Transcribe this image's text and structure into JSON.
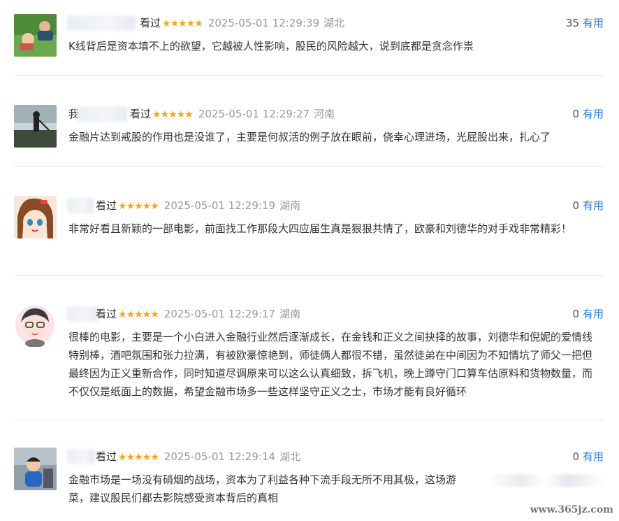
{
  "reviews": [
    {
      "status": "看过",
      "stars": "★★★★★",
      "time": "2025-05-01 12:29:39",
      "location": "湖北",
      "useful_count": "35",
      "useful_label": "有用",
      "text": "K线背后是资本填不上的欲望，它越被人性影响，股民的风险越大，说到底都是贪念作祟"
    },
    {
      "name_visible": "我",
      "status": "看过",
      "stars": "★★★★★",
      "time": "2025-05-01 12:29:27",
      "location": "河南",
      "useful_count": "0",
      "useful_label": "有用",
      "text": "金融片达到戒股的作用也是没谁了，主要是何叔活的例子放在眼前，侥幸心理进场，光屁股出来，扎心了"
    },
    {
      "status": "看过",
      "stars": "★★★★★",
      "time": "2025-05-01 12:29:19",
      "location": "湖南",
      "useful_count": "0",
      "useful_label": "有用",
      "text": "非常好看且新颖的一部电影，前面找工作那段大四应届生真是狠狠共情了，欧豪和刘德华的对手戏非常精彩！"
    },
    {
      "status": "看过",
      "stars": "★★★★★",
      "time": "2025-05-01 12:29:17",
      "location": "湖南",
      "useful_count": "0",
      "useful_label": "有用",
      "text": "很棒的电影，主要是一个小白进入金融行业然后逐渐成长，在金钱和正义之间抉择的故事，刘德华和倪妮的爱情线特别棒，酒吧氛围和张力拉满，有被欧豪惊艳到，师徒俩人都很不错，虽然徒弟在中间因为不知情坑了师父一把但最终因为正义重新合作，同时知道尽调原来可以这么认真细致，拆飞机，晚上蹲守门口算车估原料和货物数量，而不仅仅是纸面上的数据，希望金融市场多一些这样坚守正义之士，市场才能有良好循环"
    },
    {
      "status": "看过",
      "stars": "★★★★★",
      "time": "2025-05-01 12:29:14",
      "location": "湖北",
      "useful_count": "0",
      "useful_label": "有用",
      "text": "金融市场是一场没有硝烟的战场，资本为了利益各种下流手段无所不用其极，这场游",
      "text_line2": "菜，建议股民们都去影院感受资本背后的真相"
    }
  ],
  "watermark": "www.365jz.com",
  "colors": {
    "star": "#f7a51c",
    "link": "#2a7bd3",
    "meta": "#999999",
    "text": "#333333"
  }
}
